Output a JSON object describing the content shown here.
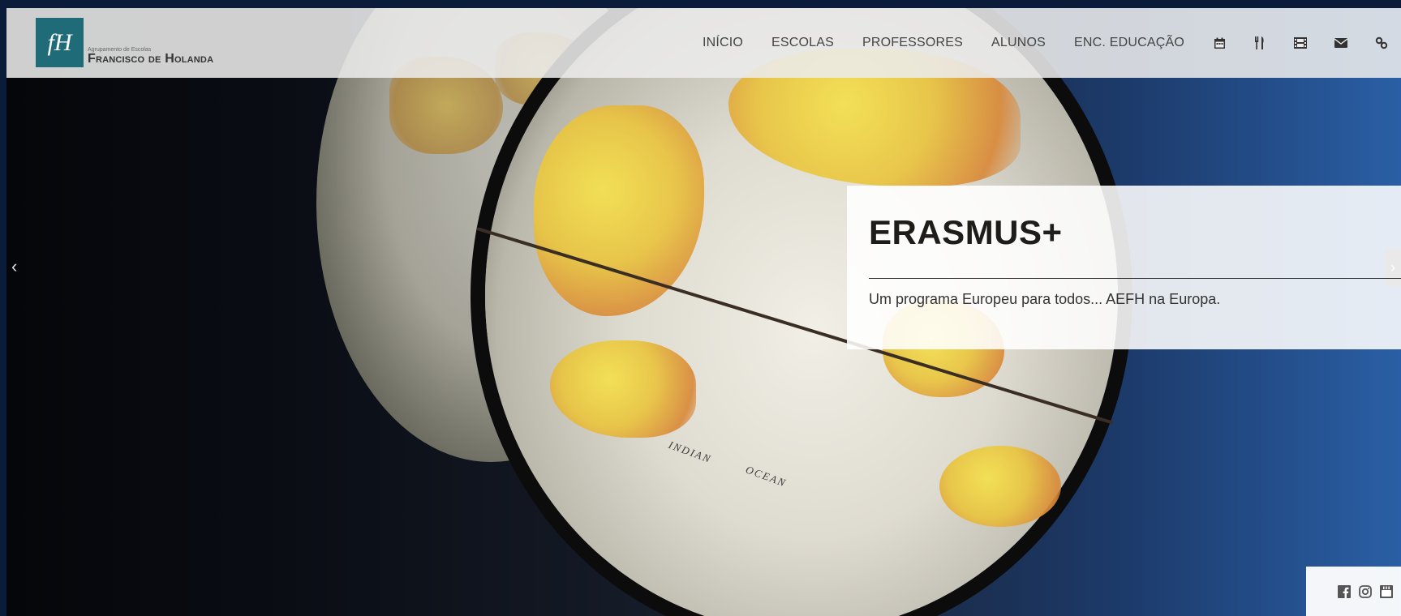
{
  "logo": {
    "small_text": "Agrupamento de Escolas",
    "name": "Francisco de Holanda",
    "mark_text": "fH"
  },
  "nav": {
    "items": [
      {
        "label": "INÍCIO"
      },
      {
        "label": "ESCOLAS"
      },
      {
        "label": "PROFESSORES"
      },
      {
        "label": "ALUNOS"
      },
      {
        "label": "ENC. EDUCAÇÃO"
      }
    ],
    "icons": [
      "calendar-icon",
      "cutlery-icon",
      "film-icon",
      "envelope-icon",
      "link-icon"
    ]
  },
  "slide": {
    "title": "ERASMUS+",
    "text": "Um programa Europeu para todos... AEFH na Europa.",
    "ocean_label_1": "INDIAN",
    "ocean_label_2": "OCEAN"
  },
  "carousel": {
    "prev_glyph": "‹",
    "next_glyph": "›"
  },
  "social": [
    "facebook-icon",
    "instagram-icon",
    "youtube-icon"
  ],
  "colors": {
    "brand": "#1f6b78",
    "navbar_bg": "#ececec",
    "caption_bg": "#ffffff"
  }
}
